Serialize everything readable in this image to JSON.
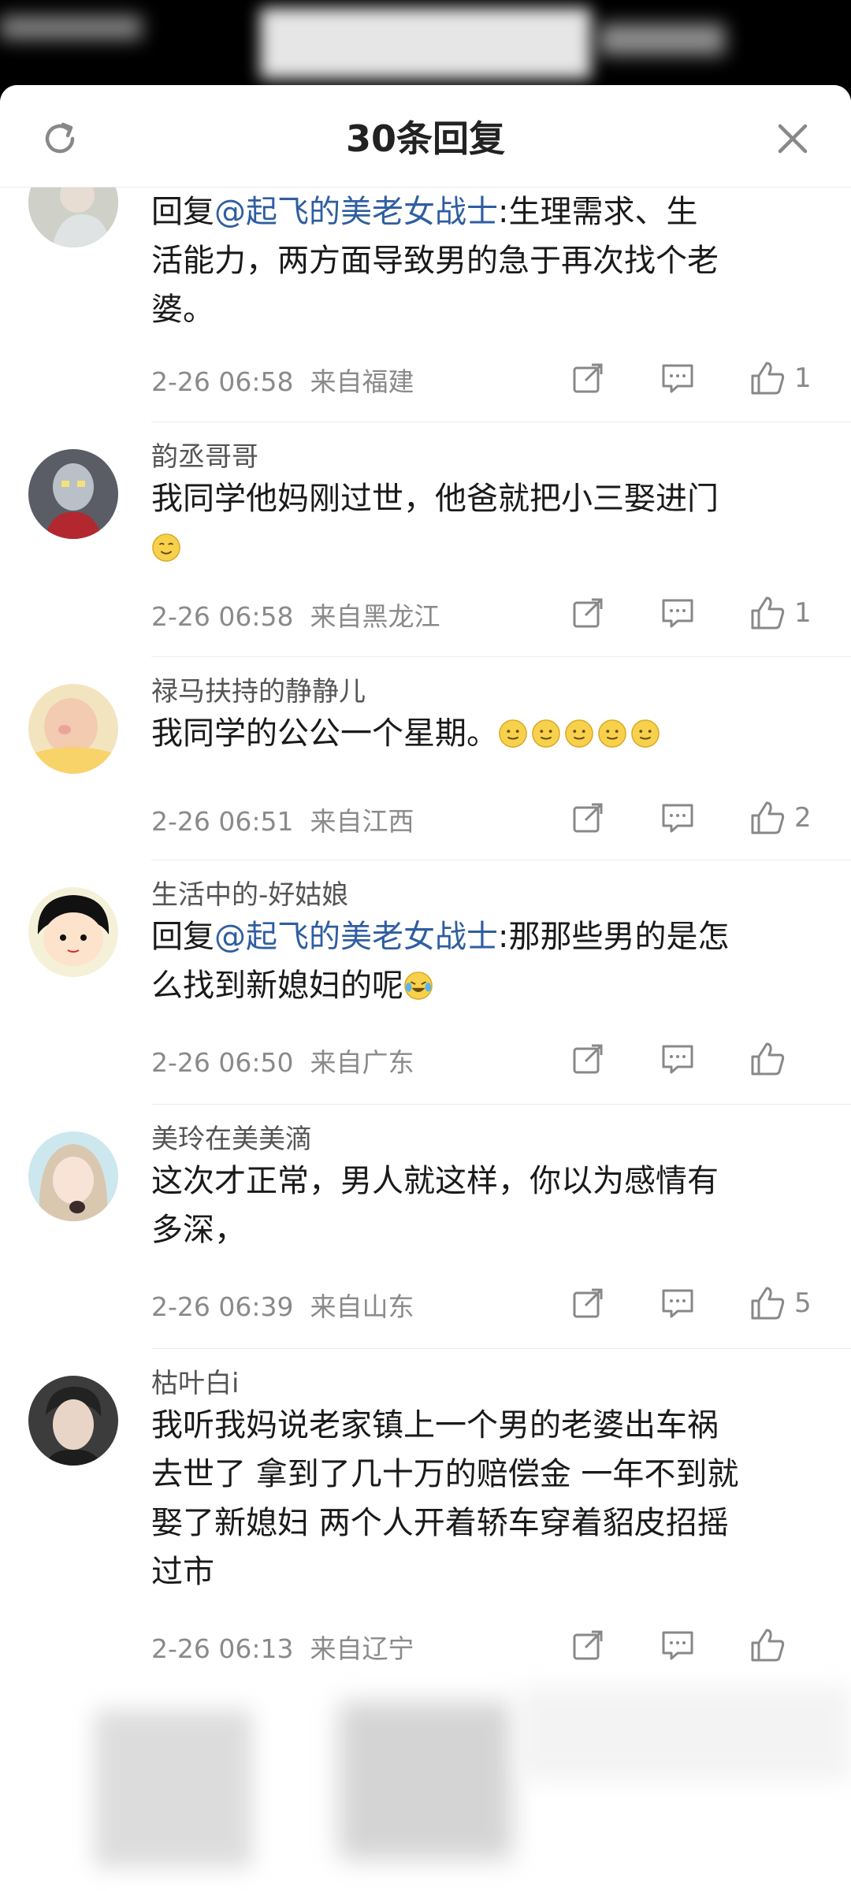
{
  "header": {
    "title": "30条回复"
  },
  "comments": [
    {
      "username": "",
      "mention": "@起飞的美老女战士",
      "prefix": "回复",
      "text_line1_after": ":生理需求、生",
      "text_line2": "活能力，两方面导致男的急于再次找个老",
      "text_line3": "婆。",
      "time": "2-26 06:58",
      "location": "来自福建",
      "likes": "1"
    },
    {
      "username": "韵丞哥哥",
      "text_line1": "我同学他妈刚过世，他爸就把小三娶进门",
      "time": "2-26 06:58",
      "location": "来自黑龙江",
      "likes": "1"
    },
    {
      "username": "禄马扶持的静静儿",
      "text_line1": "我同学的公公一个星期。",
      "time": "2-26 06:51",
      "location": "来自江西",
      "likes": "2"
    },
    {
      "username": "生活中的-好姑娘",
      "prefix": "回复",
      "mention": "@起飞的美老女战士",
      "text_line1_after": ":那那些男的是怎",
      "text_line2": "么找到新媳妇的呢",
      "time": "2-26 06:50",
      "location": "来自广东",
      "likes": ""
    },
    {
      "username": "美玲在美美滴",
      "text_line1": "这次才正常，男人就这样，你以为感情有",
      "text_line2": "多深，",
      "time": "2-26 06:39",
      "location": "来自山东",
      "likes": "5"
    },
    {
      "username": "枯叶白i",
      "text_line1": "我听我妈说老家镇上一个男的老婆出车祸",
      "text_line2": "去世了 拿到了几十万的赔偿金 一年不到就",
      "text_line3": "娶了新媳妇 两个人开着轿车穿着貂皮招摇",
      "text_line4": "过市",
      "time": "2-26 06:13",
      "location": "来自辽宁",
      "likes": ""
    }
  ],
  "colors": {
    "mention": "#2f5ea0",
    "meta": "#8a8a8a",
    "text": "#1a1a1a"
  }
}
